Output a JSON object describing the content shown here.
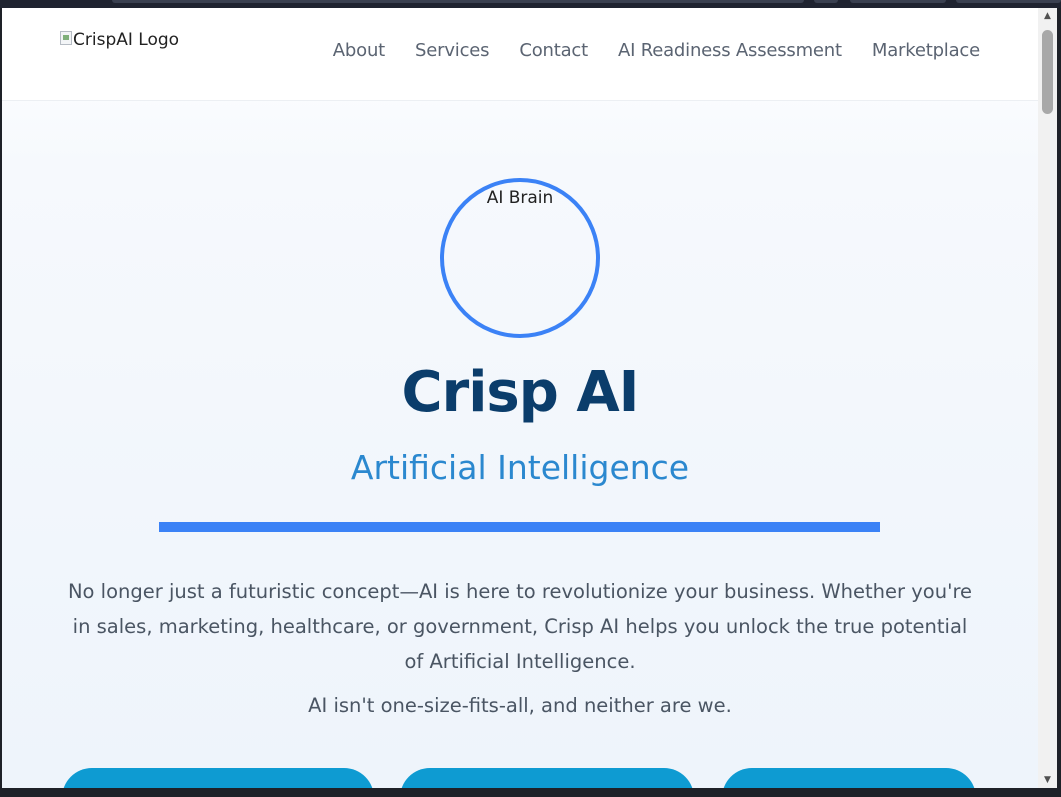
{
  "header": {
    "logo_alt": "CrispAI Logo",
    "nav": [
      "About",
      "Services",
      "Contact",
      "AI Readiness Assessment",
      "Marketplace"
    ]
  },
  "hero": {
    "image_alt": "AI Brain",
    "title": "Crisp AI",
    "subtitle": "Artificial Intelligence",
    "description": "No longer just a futuristic concept—AI is here to revolutionize your business. Whether you're in sales, marketing, healthcare, or government, Crisp AI helps you unlock the true potential of Artificial Intelligence.",
    "tagline": "AI isn't one-size-fits-all, and neither are we."
  },
  "icons": {
    "scroll_up": "triangle-up-icon",
    "scroll_down": "triangle-down-icon",
    "broken_image": "broken-image-icon"
  },
  "colors": {
    "accent": "#3b82f6",
    "title": "#0b3d6b",
    "subtitle": "#2b88cf",
    "cta": "#0e9bd2",
    "text": "#4a5563"
  }
}
